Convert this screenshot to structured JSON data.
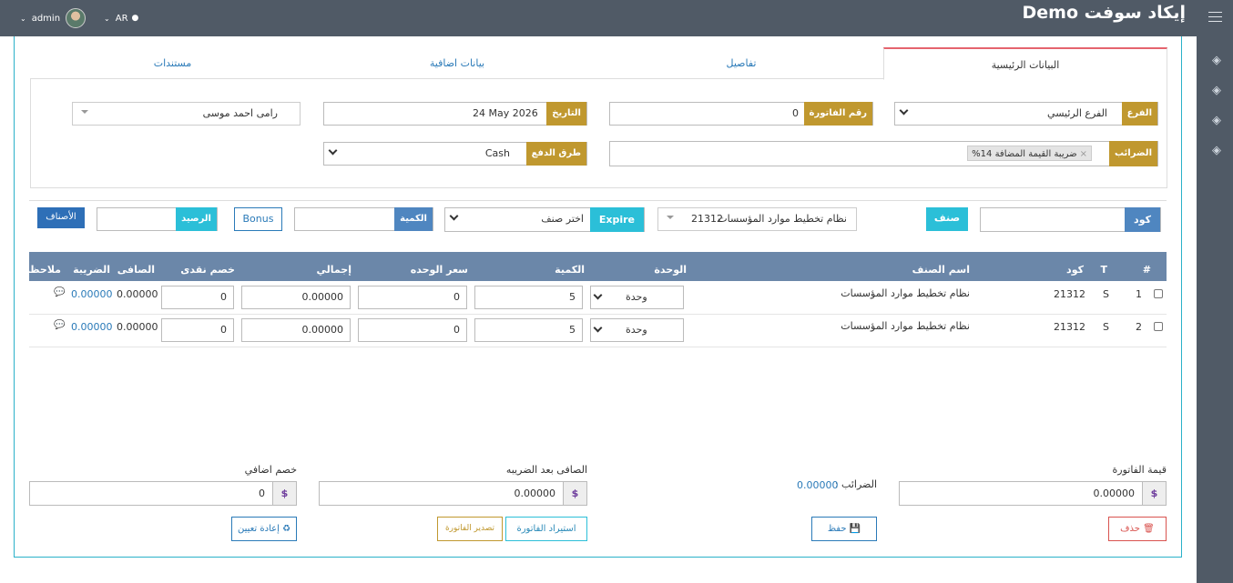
{
  "header": {
    "brand": "إيكاد سوفت Demo",
    "user": "admin",
    "language": "AR"
  },
  "sidebar": {
    "icons": [
      "layers-icon",
      "layers-icon",
      "layers-icon",
      "layers-icon"
    ]
  },
  "tabs": [
    {
      "label": "البيانات الرئيسية",
      "active": true
    },
    {
      "label": "تفاصيل",
      "active": false
    },
    {
      "label": "بيانات اضافية",
      "active": false
    },
    {
      "label": "مستندات",
      "active": false
    }
  ],
  "form": {
    "branch_label": "الفرع",
    "branch_value": "الفرع الرئيسي",
    "invoice_no_label": "رقم الفاتورة",
    "invoice_no_value": "0",
    "date_label": "التاريخ",
    "date_value": "24 May 2026",
    "person_value": "رامى احمد موسى",
    "taxes_label": "الضرائب",
    "tax_tag": "ضريبة القيمة المضافة 14%",
    "payment_label": "طرق الدفع",
    "payment_value": "Cash"
  },
  "entry": {
    "code_label": "كود",
    "code_value": "",
    "item_label": "صنف",
    "item_value": "نظام تخطيط موارد المؤسسات",
    "item_code": "21312",
    "expire_label": "Expire",
    "expire_value": "اختر صنف",
    "qty_label": "الكمية",
    "qty_value": "",
    "bonus_label": "Bonus",
    "balance_label": "الرصيد",
    "balance_value": "",
    "items_button": "الأصناف"
  },
  "table": {
    "headers": {
      "hash": "#",
      "t": "T",
      "code": "كود",
      "name": "اسم الصنف",
      "unit": "الوحدة",
      "qty": "الكمية",
      "unit_price": "سعر الوحده",
      "total": "إجمالي",
      "cash_discount": "خصم نقدى",
      "net": "الصافى",
      "tax": "الضريبة",
      "note": "ملاحظه"
    },
    "rows": [
      {
        "num": "1",
        "t": "S",
        "code": "21312",
        "name": "نظام تخطيط موارد المؤسسات",
        "unit": "وحدة",
        "qty": "5",
        "unit_price": "0",
        "total": "0.00000",
        "cash_discount": "0",
        "net": "0.00000",
        "tax": "0.00000"
      },
      {
        "num": "2",
        "t": "S",
        "code": "21312",
        "name": "نظام تخطيط موارد المؤسسات",
        "unit": "وحدة",
        "qty": "5",
        "unit_price": "0",
        "total": "0.00000",
        "cash_discount": "0",
        "net": "0.00000",
        "tax": "0.00000"
      }
    ]
  },
  "footer": {
    "invoice_value_label": "قيمة الفاتورة",
    "invoice_value": "0.00000",
    "taxes_label": "الضرائب :",
    "taxes_value": "0.00000",
    "net_after_tax_label": "الصافى بعد الضريبه",
    "net_after_tax": "0.00000",
    "extra_discount_label": "خصم اضافي",
    "extra_discount": "0",
    "currency": "$",
    "delete_button": "حذف",
    "save_button": "حفظ",
    "import_button": "استيراد الفاتورة",
    "export_button": "تصدير الفاتورة",
    "reset_button": "إعادة تعيين"
  },
  "colors": {
    "topbar": "#505a66",
    "gold": "#c0982f",
    "teal": "#2bbfd8",
    "header_blue": "#6b87a9",
    "accent_red": "#e5646e"
  }
}
